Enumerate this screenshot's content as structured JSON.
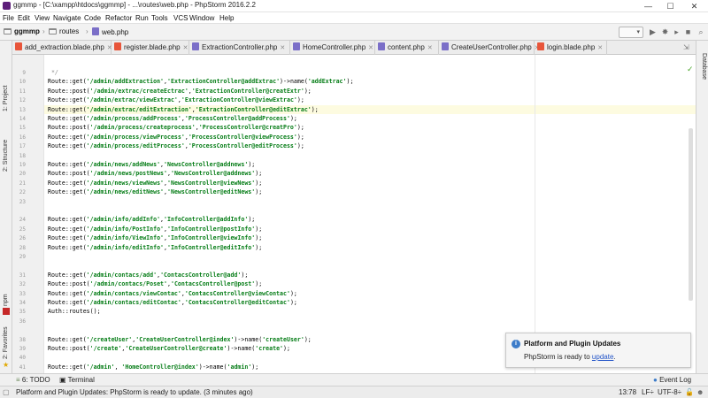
{
  "window": {
    "title": "ggmmp - [C:\\xampp\\htdocs\\ggmmp] - ...\\routes\\web.php - PhpStorm 2016.2.2",
    "controls": {
      "minimize": "—",
      "maximize": "☐",
      "close": "✕"
    }
  },
  "menu": [
    "File",
    "Edit",
    "View",
    "Navigate",
    "Code",
    "Refactor",
    "Run",
    "Tools",
    "VCS",
    "Window",
    "Help"
  ],
  "breadcrumb": {
    "project": "ggmmp",
    "folder": "routes",
    "file": "web.php"
  },
  "tabs": [
    {
      "label": "add_extraction.blade.php",
      "color": "#e8553a"
    },
    {
      "label": "register.blade.php",
      "color": "#e8553a"
    },
    {
      "label": "ExtractionController.php",
      "color": "#7b6fc8"
    },
    {
      "label": "HomeController.php",
      "color": "#7b6fc8"
    },
    {
      "label": "content.php",
      "color": "#7b6fc8"
    },
    {
      "label": "CreateUserController.php",
      "color": "#7b6fc8"
    },
    {
      "label": "login.blade.php",
      "color": "#e8553a"
    }
  ],
  "left_tools": {
    "project": "1: Project",
    "structure": "2: Structure",
    "npm": "npm",
    "favorites": "2: Favorites"
  },
  "right_tools": {
    "database": "Database"
  },
  "code_lines": [
    {
      "n": "9",
      "t": "comment",
      "text": " */"
    },
    {
      "n": "10",
      "t": "code",
      "text": "Route::get('/admin/addExtraction','ExtractionController@addExtrac')->name('addExtrac');"
    },
    {
      "n": "11",
      "t": "code",
      "text": "Route::post('/admin/extrac/createEctrac','ExtractionController@creatExtr');"
    },
    {
      "n": "12",
      "t": "code",
      "text": "Route::get('/admin/extrac/viewExtrac','ExtractionController@viewExtrac');"
    },
    {
      "n": "13",
      "t": "code",
      "text": "Route::get('/admin/extrac/editExtraction','ExtractionController@editExtrac');",
      "current": true
    },
    {
      "n": "14",
      "t": "code",
      "text": "Route::get('/admin/process/addProcess','ProcessController@addProcess');"
    },
    {
      "n": "15",
      "t": "code",
      "text": "Route::post('/admin/process/createprocess','ProcessController@creatPro');"
    },
    {
      "n": "16",
      "t": "code",
      "text": "Route::get('/admin/process/viewProcess','ProcessController@viewProcess');"
    },
    {
      "n": "17",
      "t": "code",
      "text": "Route::get('/admin/process/editProcess','ProcessController@editProcess');"
    },
    {
      "n": "18",
      "t": "blank",
      "text": ""
    },
    {
      "n": "19",
      "t": "code",
      "text": "Route::get('/admin/news/addNews','NewsController@addnews');"
    },
    {
      "n": "20",
      "t": "code",
      "text": "Route::post('/admin/news/postNews','NewsController@addnews');"
    },
    {
      "n": "21",
      "t": "code",
      "text": "Route::get('/admin/news/viewNews','NewsController@viewNews');"
    },
    {
      "n": "22",
      "t": "code",
      "text": "Route::get('/admin/news/editNews','NewsController@editNews');"
    },
    {
      "n": "23",
      "t": "blank",
      "text": ""
    },
    {
      "n": "",
      "t": "blank",
      "text": ""
    },
    {
      "n": "24",
      "t": "code",
      "text": "Route::get('/admin/info/addInfo','InfoController@addInfo');"
    },
    {
      "n": "25",
      "t": "code",
      "text": "Route::get('/admin/info/PostInfo','InfoController@postInfo');"
    },
    {
      "n": "26",
      "t": "code",
      "text": "Route::get('/admin/info/ViewInfo','InfoController@viewInfo');"
    },
    {
      "n": "28",
      "t": "code",
      "text": "Route::get('/admin/info/editInfo','InfoController@editInfo');"
    },
    {
      "n": "29",
      "t": "blank",
      "text": ""
    },
    {
      "n": "",
      "t": "blank",
      "text": ""
    },
    {
      "n": "31",
      "t": "code",
      "text": "Route::get('/admin/contacs/add','ContacsController@add');"
    },
    {
      "n": "32",
      "t": "code",
      "text": "Route::post('/admin/contacs/Poset','ContacsController@post');"
    },
    {
      "n": "33",
      "t": "code",
      "text": "Route::get('/admin/contacs/viewContac','ContacsController@viewContac');"
    },
    {
      "n": "34",
      "t": "code",
      "text": "Route::get('/admin/contacs/editContac','ContacsController@editContac');"
    },
    {
      "n": "35",
      "t": "code",
      "text": "Auth::routes();"
    },
    {
      "n": "36",
      "t": "blank",
      "text": ""
    },
    {
      "n": "",
      "t": "blank",
      "text": ""
    },
    {
      "n": "38",
      "t": "code",
      "text": "Route::get('/createUser','CreateUserController@index')->name('createUser');"
    },
    {
      "n": "39",
      "t": "code",
      "text": "Route::post('/create','CreateUserController@create')->name('create');"
    },
    {
      "n": "40",
      "t": "blank",
      "text": ""
    },
    {
      "n": "41",
      "t": "code",
      "text": "Route::get('/admin', 'HomeController@index')->name('admin');"
    }
  ],
  "notification": {
    "title": "Platform and Plugin Updates",
    "body_prefix": "PhpStorm is ready to ",
    "link": "update",
    "body_suffix": "."
  },
  "tool_windows": {
    "todo": "6: TODO",
    "terminal": "Terminal",
    "event_log": "Event Log"
  },
  "status": {
    "message": "Platform and Plugin Updates: PhpStorm is ready to update. (3 minutes ago)",
    "position": "13:78",
    "line_sep": "LF÷",
    "encoding": "UTF-8÷"
  }
}
